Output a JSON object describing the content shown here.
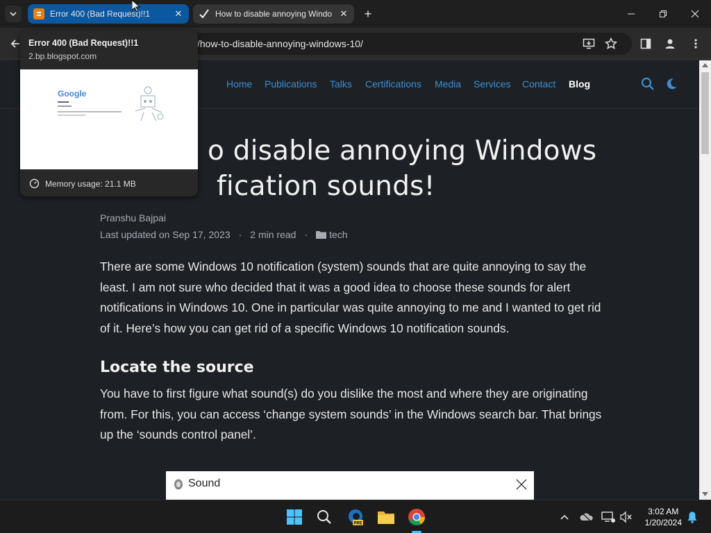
{
  "tabs": [
    {
      "title": "Error 400 (Bad Request)!!1",
      "active": true
    },
    {
      "title": "How to disable annoying Windo",
      "active": false
    }
  ],
  "hover_card": {
    "title": "Error 400 (Bad Request)!!1",
    "domain": "2.bp.blogspot.com",
    "memory": "Memory usage: 21.1 MB",
    "thumb_logo": "Google"
  },
  "address_bar": {
    "url": "/how-to-disable-annoying-windows-10/"
  },
  "nav": {
    "links": [
      "Home",
      "Publications",
      "Talks",
      "Certifications",
      "Media",
      "Services",
      "Contact",
      "Blog"
    ],
    "active": "Blog"
  },
  "post": {
    "title": "How to disable annoying Windows 10 notification sounds!",
    "title_line1": "o disable annoying Windows",
    "title_line2": "fication sounds!",
    "author": "Pranshu Bajpai",
    "updated": "Last updated on Sep 17, 2023",
    "read_time": "2 min read",
    "category": "tech",
    "para1": "There are some Windows 10 notification (system) sounds that are quite annoying to say the least. I am not sure who decided that it was a good idea to choose these sounds for alert notifications in Windows 10. One in particular was quite annoying to me and I wanted to get rid of it. Here’s how you can get rid of a specific Windows 10 notification sounds.",
    "heading": "Locate the source",
    "para2": "You have to first figure what sound(s) do you dislike the most and where they are originating from. For this, you can access ‘change system sounds’ in the Windows search bar. That brings up the ‘sounds control panel’.",
    "image_label": "Sound"
  },
  "taskbar": {
    "time": "3:02 AM",
    "date": "1/20/2024",
    "apps": [
      "windows-start",
      "search",
      "edge-preview",
      "file-explorer",
      "chrome"
    ]
  },
  "colors": {
    "tab_active": "#0b57a0",
    "nav_link": "#3a8fd6",
    "page_bg": "#1d2025"
  }
}
